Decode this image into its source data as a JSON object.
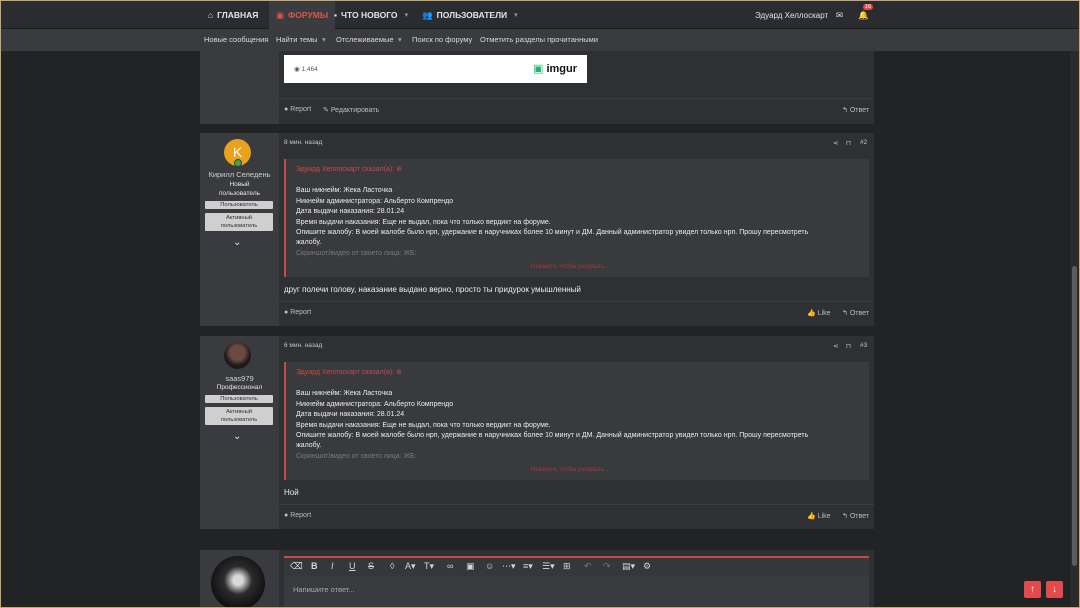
{
  "nav": {
    "home": "ГЛАВНАЯ",
    "forums": "ФОРУМЫ",
    "whats_new": "ЧТО НОВОГО",
    "users": "ПОЛЬЗОВАТЕЛИ",
    "username": "Эдуард Хеллоскарт",
    "alerts": "16"
  },
  "subnav": {
    "new_posts": "Новые сообщения",
    "find_threads": "Найти темы",
    "watched": "Отслеживаемые",
    "search": "Поиск по форуму",
    "mark_read": "Отметить разделы прочитанными"
  },
  "prev_post": {
    "views": "1,464",
    "imgur": "imgur",
    "report": "Report",
    "edit": "Редактировать",
    "reply": "Ответ"
  },
  "posts": [
    {
      "avatar_letter": "K",
      "author": "Кирилл Селедень",
      "title_lines": [
        "Новый",
        "пользователь"
      ],
      "badge1": "Пользователь",
      "badge2_lines": [
        "Активный",
        "пользователь"
      ],
      "time": "8 мин. назад",
      "num": "#2",
      "quote_head": "Эдуард Хеллоскарт сказал(а): ⊕",
      "quote_lines": [
        "Ваш никнейм: Жека Ласточка",
        "Никнейм администратора: Альберто Компрендо",
        "Дата выдачи наказания: 28.01.24",
        "Время выдачи наказания: Еще не выдал, пока что только вердикт на форуме.",
        "Опишите жалобу: В моей жалобе было нрп, удержание в наручниках более 10 минут и ДМ. Данный администратор увидел только нрп. Прошу пересмотреть",
        "жалобу."
      ],
      "quote_fade": "Скриншот/видео от своего лица: ЖБ:",
      "quote_more": "Нажмите, чтобы раскрыть...",
      "text": "друг полечи голову, наказание выдано верно, просто ты придурок умышленный",
      "report": "Report",
      "like": "Like",
      "reply": "Ответ"
    },
    {
      "author": "saas979",
      "title_lines": [
        "Профессионал"
      ],
      "badge1": "Пользователь",
      "badge2_lines": [
        "Активный",
        "пользователь"
      ],
      "time": "6 мин. назад",
      "num": "#3",
      "quote_head": "Эдуард Хеллоскарт сказал(а): ⊕",
      "quote_lines": [
        "Ваш никнейм: Жека Ласточка",
        "Никнейм администратора: Альберто Компрендо",
        "Дата выдачи наказания: 28.01.24",
        "Время выдачи наказания: Еще не выдал, пока что только вердикт на форуме.",
        "Опишите жалобу: В моей жалобе было нрп, удержание в наручниках более 10 минут и ДМ. Данный администратор увидел только нрп. Прошу пересмотреть",
        "жалобу."
      ],
      "quote_fade": "Скриншот/видео от своего лица: ЖБ:",
      "quote_more": "Нажмите, чтобы раскрыть...",
      "text": "Ной",
      "report": "Report",
      "like": "Like",
      "reply": "Ответ"
    }
  ],
  "editor": {
    "placeholder": "Напишите ответ..."
  },
  "colors": {
    "accent": "#c94a44",
    "bg": "#222325"
  }
}
